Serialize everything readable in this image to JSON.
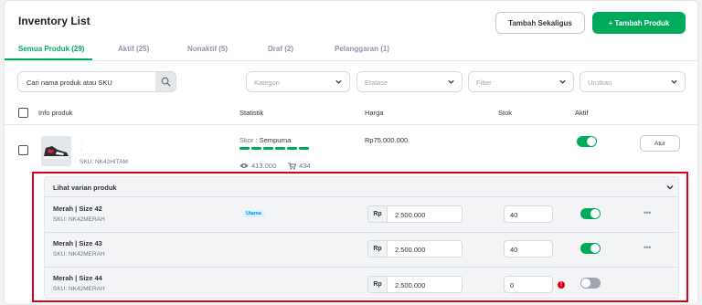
{
  "header": {
    "title": "Inventory List",
    "bulk_add_label": "Tambah Sekaligus",
    "add_product_label": "+ Tambah Produk"
  },
  "tabs": [
    {
      "label": "Semua Produk (29)",
      "active": true
    },
    {
      "label": "Aktif (25)"
    },
    {
      "label": "Nonaktif (5)"
    },
    {
      "label": "Draf (2)"
    },
    {
      "label": "Pelanggaran (1)"
    }
  ],
  "filters": {
    "search_placeholder": "Cari nama produk atau SKU",
    "category": "Kategori",
    "showcase": "Etalase",
    "filter": "Filter",
    "sort": "Urutkan"
  },
  "table": {
    "columns": [
      "Info produk",
      "Statistik",
      "Harga",
      "Stok",
      "Aktif"
    ]
  },
  "product": {
    "name": "·",
    "sku": "SKU: NK42HITAM",
    "score_label": "Skor :",
    "score_value": "Sempurna",
    "views": "413.000",
    "sold": "434",
    "price": "Rp75.000.000",
    "active": true,
    "action_label": "Atur"
  },
  "variants": {
    "header_label": "Lihat varian produk",
    "items": [
      {
        "name": "Merah  |  Size 42",
        "sku": "SKU: NK42MERAH",
        "badge": "Utama",
        "currency": "Rp",
        "price": "2.500.000",
        "stock": "40",
        "active": true,
        "menu": "•••"
      },
      {
        "name": "Merah  |  Size 43",
        "sku": "SKU: NK42MERAH",
        "currency": "Rp",
        "price": "2.500.000",
        "stock": "40",
        "active": true,
        "menu": "•••"
      },
      {
        "name": "Merah  |  Size 44",
        "sku": "SKU: NK42MERAH",
        "currency": "Rp",
        "price": "2.500.000",
        "stock": "0",
        "warning": "!",
        "active": false
      }
    ]
  },
  "colors": {
    "accent": "#00aa5b",
    "highlight_border": "#e1001a",
    "badge_bg": "#d6f3ff",
    "badge_text": "#0095da"
  }
}
